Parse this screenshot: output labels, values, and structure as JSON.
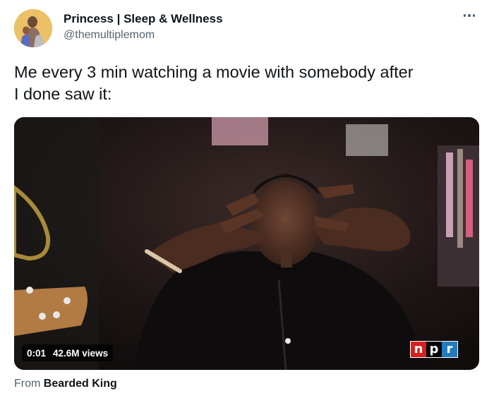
{
  "author": {
    "name": "Princess | Sleep & Wellness",
    "handle": "@themultiplemom"
  },
  "tweet": {
    "text_line1": "Me every 3 min watching a movie with somebody after",
    "text_line2": "I done saw it:"
  },
  "media": {
    "time": "0:01",
    "views": "42.6M views",
    "logo_letters": [
      "n",
      "p",
      "r"
    ],
    "logo_colors": [
      "#d62021",
      "#000000",
      "#237bbd"
    ]
  },
  "source": {
    "prefix": "From",
    "name": "Bearded King"
  },
  "icons": {
    "more": "more-horizontal-icon",
    "avatar": "user-avatar"
  },
  "colors": {
    "text_primary": "#0f1419",
    "text_secondary": "#536471"
  }
}
